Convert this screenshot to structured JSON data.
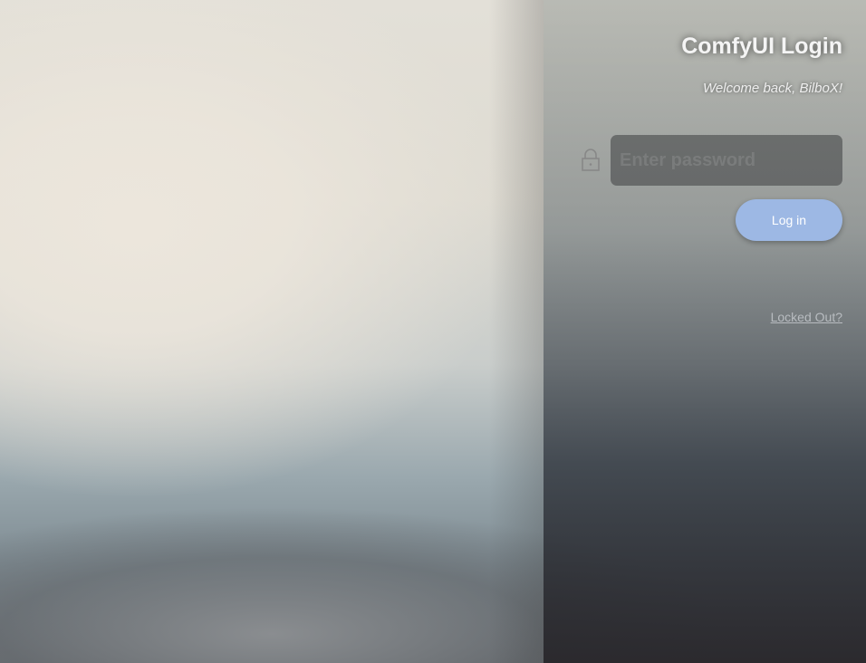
{
  "login": {
    "title": "ComfyUI Login",
    "welcome": "Welcome back, BilboX!",
    "password_placeholder": "Enter password",
    "password_value": "",
    "login_button": "Log in",
    "locked_out_link": "Locked Out?",
    "accent_color": "#9db8e4",
    "lock_icon": "lock-icon"
  }
}
